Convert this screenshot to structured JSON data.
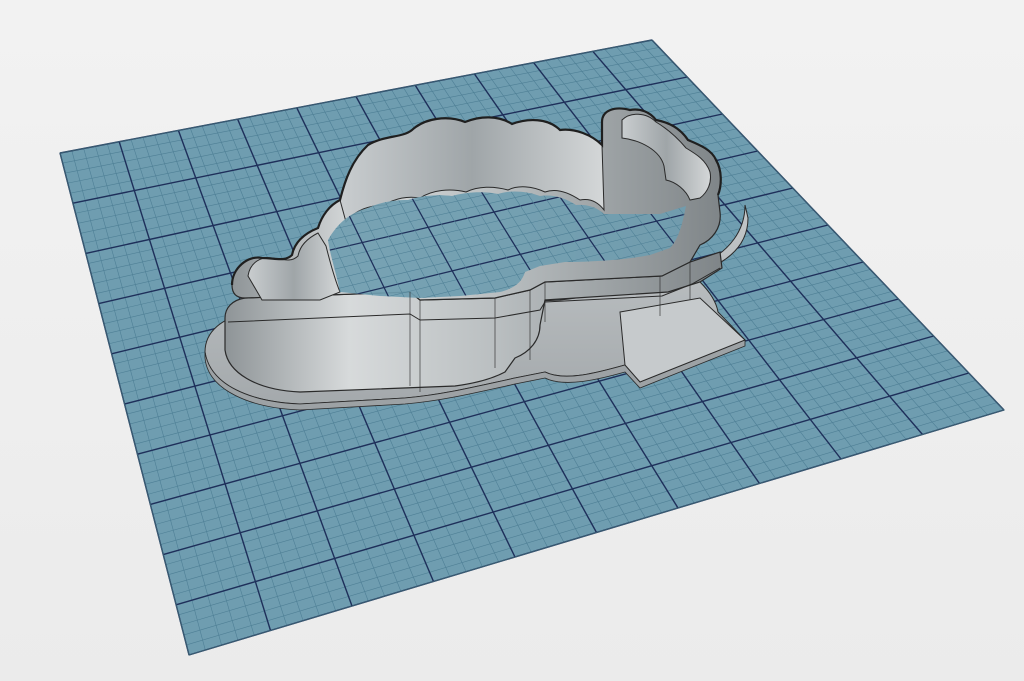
{
  "viewport": {
    "background": "#efefef",
    "grid_plane_color": "#6f9db0",
    "grid_major_line_color": "#1e2f5a",
    "grid_minor_line_color": "#4e7f95",
    "grid_major_divisions": 10,
    "grid_minor_per_major": 5
  },
  "model": {
    "name": "",
    "face_color": "#d0d3d4",
    "shadow_color": "#9ea3a6",
    "edge_color": "#2a2a2a"
  }
}
